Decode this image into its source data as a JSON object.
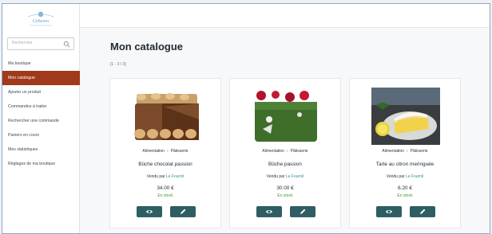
{
  "sidebar": {
    "logo_text": "Cabanes",
    "search_placeholder": "Rechercher",
    "items": [
      {
        "label": "Ma boutique"
      },
      {
        "label": "Mon catalogue",
        "active": true
      },
      {
        "label": "Ajouter un produit"
      },
      {
        "label": "Commandes à traiter"
      },
      {
        "label": "Rechercher une commande"
      },
      {
        "label": "Paniers en cours"
      },
      {
        "label": "Mes statistiques"
      },
      {
        "label": "Réglages de ma boutique"
      }
    ]
  },
  "page": {
    "title": "Mon catalogue",
    "range": "[1 - 3 / 3]"
  },
  "products": [
    {
      "category": "Alimentation",
      "subcategory": "Pâtisserie",
      "name": "Bûche chocolat passion",
      "sold_by_label": "Vendu par",
      "seller": "Le Fournil",
      "price": "34.00 €",
      "stock": "En stock"
    },
    {
      "category": "Alimentation",
      "subcategory": "Pâtisserie",
      "name": "Bûche passion",
      "sold_by_label": "Vendu par",
      "seller": "Le Fournil",
      "price": "30.00 €",
      "stock": "En stock"
    },
    {
      "category": "Alimentation",
      "subcategory": "Pâtisserie",
      "name": "Tarte au citron meringuée",
      "sold_by_label": "Vendu par",
      "seller": "Le Fournil",
      "price": "6.20 €",
      "stock": "En stock"
    }
  ],
  "icons": {
    "search": "search-icon",
    "view": "eye-icon",
    "edit": "pencil-icon"
  },
  "colors": {
    "active_nav": "#a03a1a",
    "button": "#2e5e63",
    "link": "#2f8f96",
    "in_stock": "#3a9a3a"
  }
}
